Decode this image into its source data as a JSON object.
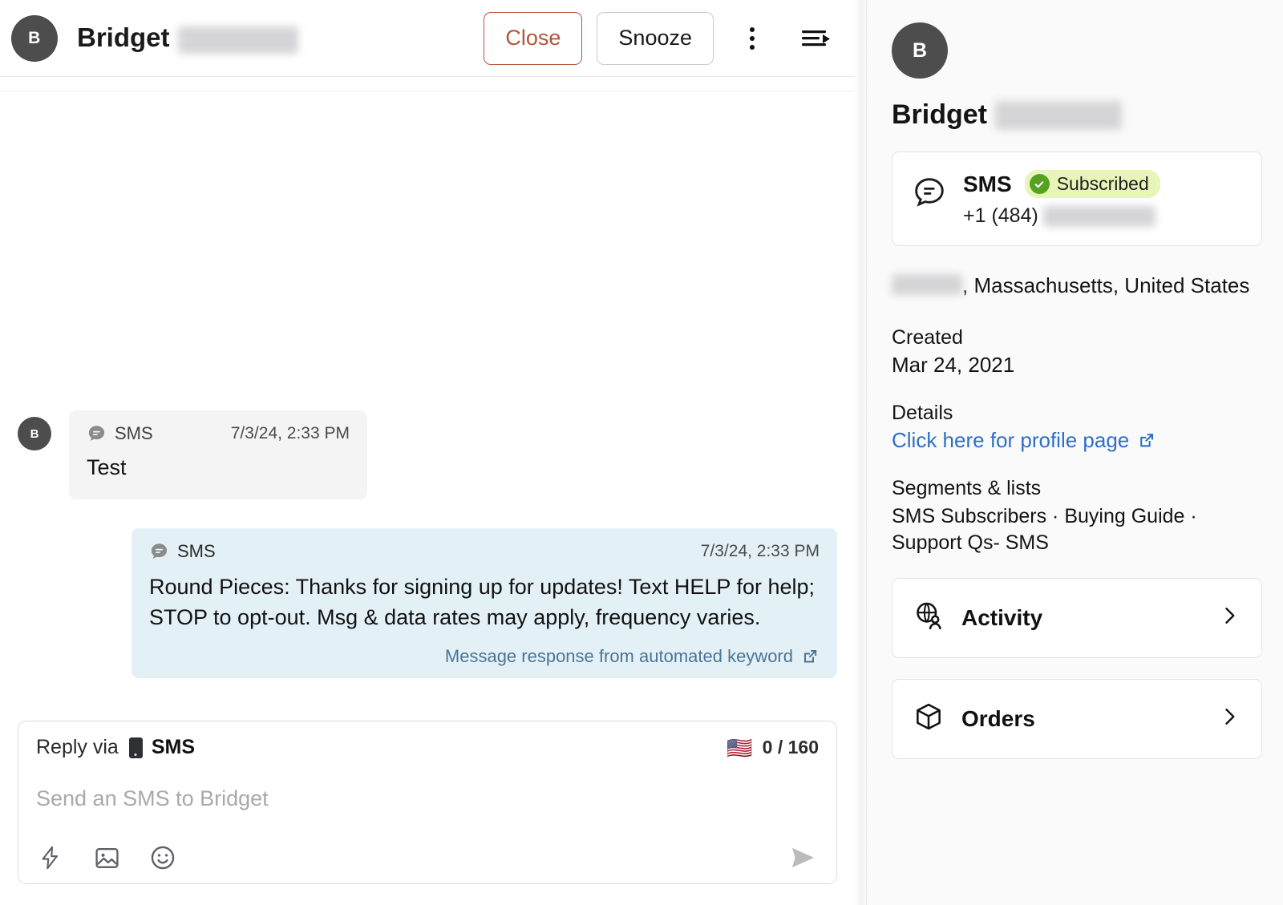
{
  "conversation": {
    "header": {
      "avatar_initial": "B",
      "title": "Bridget",
      "close_label": "Close",
      "snooze_label": "Snooze",
      "more_icon": "kebab-menu-icon",
      "panel_icon": "collapse-panel-icon"
    },
    "messages": [
      {
        "direction": "incoming",
        "avatar_initial": "B",
        "channel": "SMS",
        "timestamp": "7/3/24, 2:33 PM",
        "body": "Test"
      },
      {
        "direction": "outgoing",
        "channel": "SMS",
        "timestamp": "7/3/24, 2:33 PM",
        "body": "Round Pieces: Thanks for signing up for updates! Text HELP for help; STOP to opt-out. Msg & data rates may apply, frequency varies.",
        "footnote": "Message response from automated keyword"
      }
    ],
    "composer": {
      "reply_via_label": "Reply via",
      "channel_label": "SMS",
      "flag": "🇺🇸",
      "counter": "0 / 160",
      "placeholder": "Send an SMS to Bridget",
      "tools": [
        "quick-reply-icon",
        "image-icon",
        "emoji-icon"
      ],
      "send_icon": "send-icon"
    }
  },
  "profile": {
    "avatar_initial": "B",
    "name": "Bridget",
    "sms_card": {
      "label": "SMS",
      "status": "Subscribed",
      "phone": "+1 (484)"
    },
    "location": ", Massachusetts, United States",
    "created_label": "Created",
    "created_value": "Mar 24, 2021",
    "details_label": "Details",
    "details_link": "Click here for profile page",
    "segments_label": "Segments & lists",
    "segments_value": "SMS Subscribers · Buying Guide · Support Qs- SMS",
    "nav": [
      {
        "label": "Activity",
        "icon": "activity-globe-person-icon"
      },
      {
        "label": "Orders",
        "icon": "orders-box-icon"
      }
    ]
  },
  "colors": {
    "close_accent": "#b5543a",
    "link": "#2f6fc4",
    "bubble_out": "#e3f1f7",
    "bubble_in": "#f4f4f5",
    "badge_bg": "#e7f5b8",
    "badge_check": "#55a122",
    "avatar_bg": "#4d4d4d"
  }
}
